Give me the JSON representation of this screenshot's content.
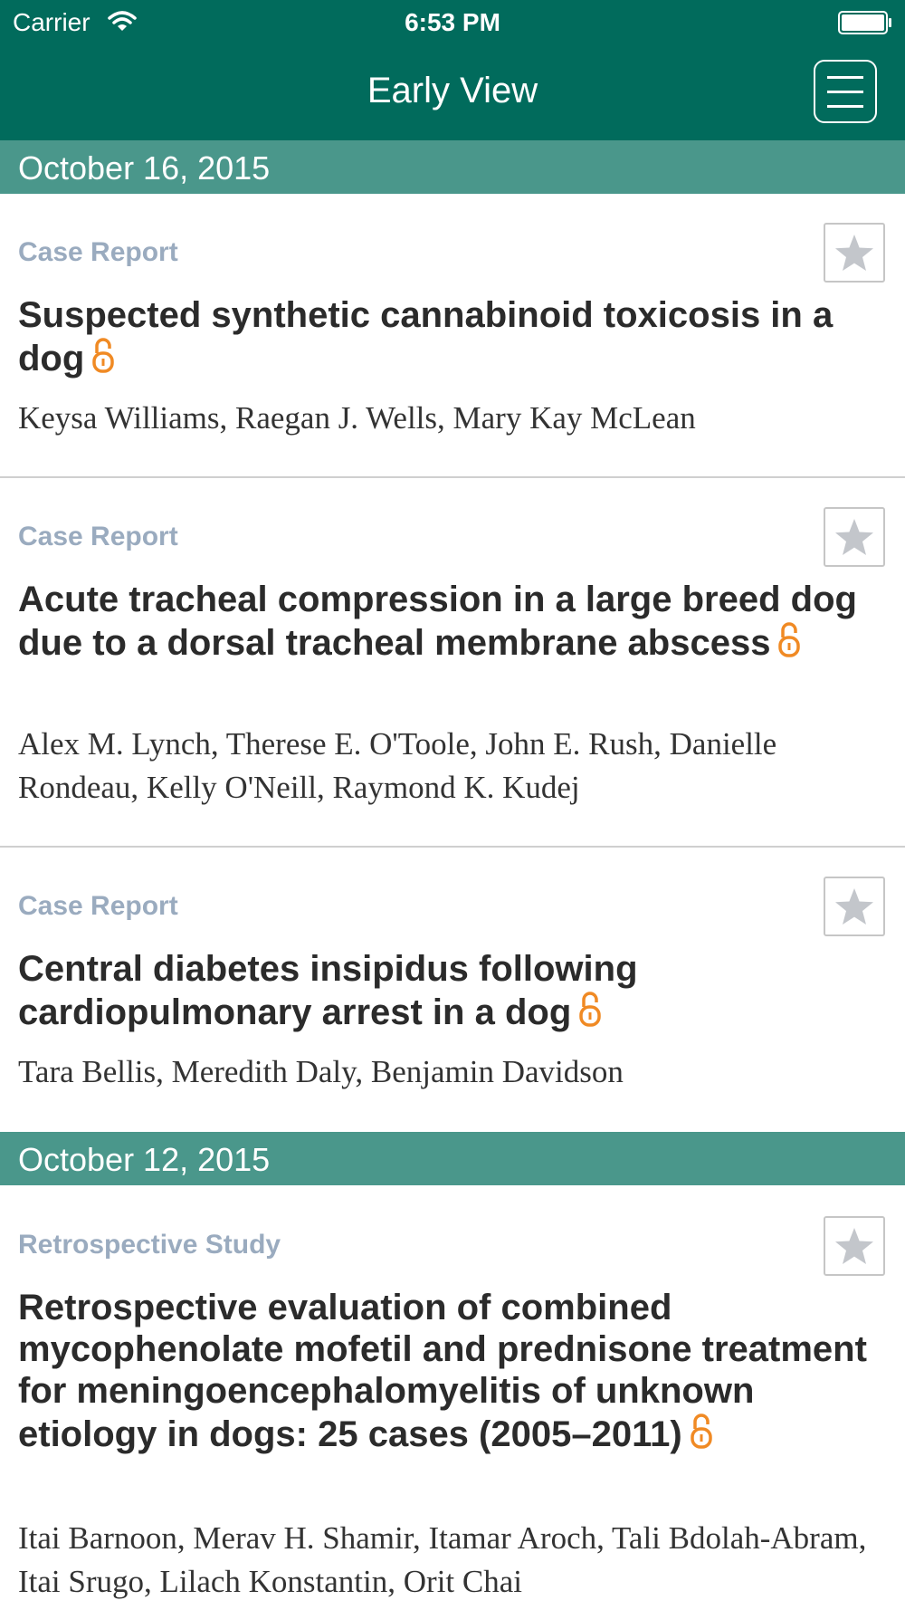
{
  "status_bar": {
    "carrier": "Carrier",
    "time": "6:53 PM"
  },
  "nav": {
    "title": "Early View"
  },
  "sections": [
    {
      "date": "October 16, 2015",
      "articles": [
        {
          "category": "Case Report",
          "title": "Suspected synthetic cannabinoid toxicosis in a dog",
          "authors": "Keysa Williams, Raegan J. Wells, Mary Kay McLean"
        },
        {
          "category": "Case Report",
          "title": "Acute tracheal compression in a large breed dog due to a dorsal tracheal membrane abscess",
          "authors": "Alex M. Lynch, Therese E. O'Toole, John E. Rush, Danielle Rondeau, Kelly O'Neill, Raymond K. Kudej"
        },
        {
          "category": "Case Report",
          "title": "Central diabetes insipidus following cardiopulmonary arrest in a dog",
          "authors": "Tara Bellis, Meredith Daly, Benjamin Davidson"
        }
      ]
    },
    {
      "date": "October 12, 2015",
      "articles": [
        {
          "category": "Retrospective Study",
          "title": "Retrospective evaluation of combined mycophenolate mofetil and prednisone treatment for meningoencephalomyelitis of unknown etiology in dogs: 25 cases (2005–2011)",
          "authors": "Itai Barnoon, Merav H. Shamir, Itamar Aroch, Tali Bdolah-Abram, Itai Srugo, Lilach Konstantin, Orit Chai"
        }
      ]
    }
  ],
  "icons": {
    "open_access": "open-lock-icon",
    "favorite": "star-icon",
    "menu": "hamburger-menu-icon"
  },
  "colors": {
    "nav_background": "#016b5c",
    "date_header_background": "#4a978b",
    "category_text": "#9aabbf",
    "open_access_icon": "#f08a24"
  }
}
